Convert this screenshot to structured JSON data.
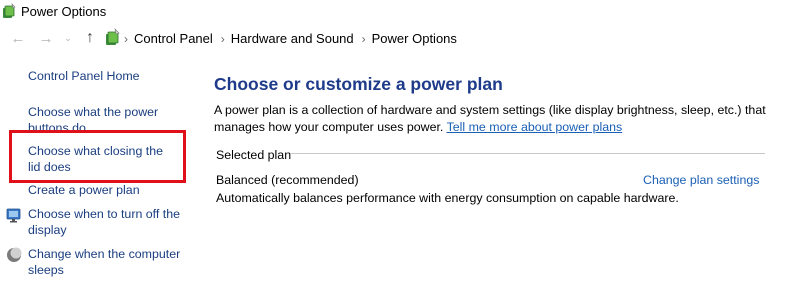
{
  "window": {
    "title": "Power Options"
  },
  "nav": {
    "breadcrumbs": [
      "Control Panel",
      "Hardware and Sound",
      "Power Options"
    ]
  },
  "sidebar": {
    "home": "Control Panel Home",
    "items": [
      "Choose what the power buttons do",
      "Choose what closing the lid does",
      "Create a power plan",
      "Choose when to turn off the display",
      "Change when the computer sleeps"
    ]
  },
  "main": {
    "title": "Choose or customize a power plan",
    "description": "A power plan is a collection of hardware and system settings (like display brightness, sleep, etc.) that manages how your computer uses power.",
    "learn_more_link": "Tell me more about power plans",
    "selected_plan_label": "Selected plan",
    "plan_name": "Balanced (recommended)",
    "change_settings_link": "Change plan settings",
    "plan_description": "Automatically balances performance with energy consumption on capable hardware."
  },
  "colors": {
    "link": "#1a3e80",
    "title": "#1e3a8a",
    "highlight": "#e0101a"
  }
}
